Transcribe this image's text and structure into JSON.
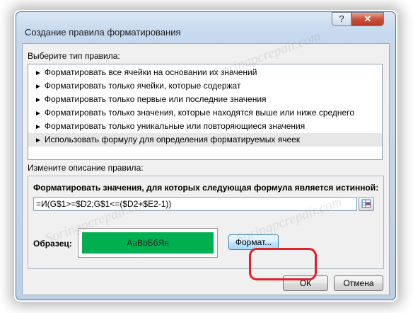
{
  "dialog": {
    "title": "Создание правила форматирования",
    "help_label": "?",
    "close_label": "✕"
  },
  "rule_type": {
    "label": "Выберите тип правила:",
    "items": [
      {
        "label": "Форматировать все ячейки на основании их значений",
        "selected": false
      },
      {
        "label": "Форматировать только ячейки, которые содержат",
        "selected": false
      },
      {
        "label": "Форматировать только первые или последние значения",
        "selected": false
      },
      {
        "label": "Форматировать только значения, которые находятся выше или ниже среднего",
        "selected": false
      },
      {
        "label": "Форматировать только уникальные или повторяющиеся значения",
        "selected": false
      },
      {
        "label": "Использовать формулу для определения форматируемых ячеек",
        "selected": true
      }
    ],
    "arrow": "►"
  },
  "description": {
    "label": "Измените описание правила:",
    "formula_heading": "Форматировать значения, для которых следующая формула является истинной:",
    "formula_value": "=И(G$1>=$D2;G$1<=($D2+$E2-1))",
    "preview_label": "Образец:",
    "preview_text": "АаВbБбЯя",
    "preview_color": "#00b050",
    "format_button": "Формат..."
  },
  "buttons": {
    "ok": "ОК",
    "cancel": "Отмена"
  },
  "highlight_color": "#e0202a",
  "watermark": "Soringpcrepair.com"
}
